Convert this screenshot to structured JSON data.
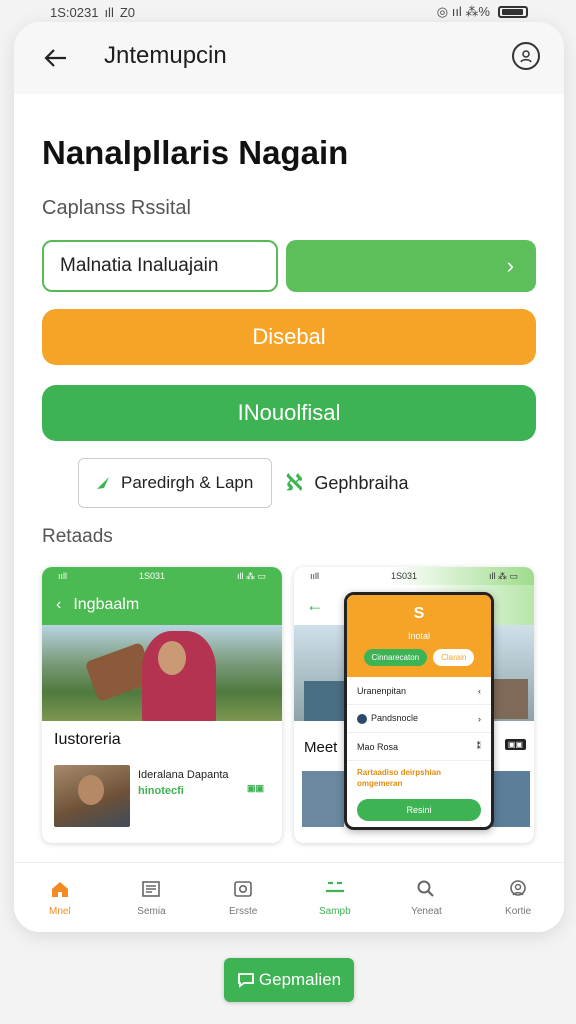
{
  "status_bar": {
    "time": "1S:0231",
    "signal": "ıll",
    "extra": "Z0",
    "right_icons": "◎ ııl ⁂%"
  },
  "app_bar": {
    "title": "Jntemupcin",
    "back_icon": "arrow-left-icon",
    "profile_icon": "profile-icon"
  },
  "page": {
    "title": "Nanalpllaris Nagain",
    "subtitle": "Caplanss Rssital",
    "input_value": "Malnatia Inaluajain",
    "go_arrow": "›",
    "orange_button": "Disebal",
    "green_button": "INouolfisal",
    "chip_outline": "Paredirgh & Lapn",
    "chip_plain": "Gephbraiha",
    "section_label": "Retaads"
  },
  "card1": {
    "status_left": "ııll",
    "status_time": "1S031",
    "status_right": "ıll ⁂ ▭",
    "appbar_title": "Ingbaalm",
    "heading": "Iustoreria",
    "row_title": "Ideralana Dapanta",
    "row_sub": "hinotecfi",
    "row_badge": "▣▣"
  },
  "card2": {
    "status_left": "ııll",
    "status_time": "1S031",
    "status_right": "ıll ⁂ ▭",
    "heading": "Meet",
    "badge": "▣▣",
    "overlay": {
      "logo": "S",
      "title": "Inotal",
      "tab_a": "Cinnarecaton",
      "tab_b": "Clarain",
      "items": [
        {
          "label": "Uranenpitan",
          "mark": "‹"
        },
        {
          "label": "Pandsnocle",
          "mark": "›"
        },
        {
          "label": "Mao Rosa",
          "mark": "⁑"
        }
      ],
      "note": "Rartaadiso deirpshian omgemeran",
      "button": "Resini"
    }
  },
  "bottom_nav": [
    {
      "label": "Mnel",
      "icon": "home-icon"
    },
    {
      "label": "Semia",
      "icon": "news-icon"
    },
    {
      "label": "Ersste",
      "icon": "camera-icon"
    },
    {
      "label": "Sampb",
      "icon": "menu-icon"
    },
    {
      "label": "Yeneat",
      "icon": "search-icon"
    },
    {
      "label": "Kortie",
      "icon": "account-icon"
    }
  ],
  "floating_button": {
    "label": "Gepmalien",
    "icon": "chat-icon"
  },
  "colors": {
    "green": "#3eb353",
    "orange": "#f5a428",
    "accent_nav": "#f38a22"
  }
}
